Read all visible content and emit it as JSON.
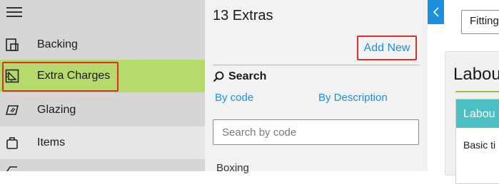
{
  "nav": {
    "menu_icon": "hamburger-icon",
    "items": [
      {
        "label": "Backing",
        "icon": "backing-icon"
      },
      {
        "label": "Extra Charges",
        "icon": "ruler-square-icon",
        "selected": true
      },
      {
        "label": "Glazing",
        "icon": "glazing-icon"
      },
      {
        "label": "Items",
        "icon": "items-icon"
      }
    ]
  },
  "list_panel": {
    "title": "13 Extras",
    "add_new_label": "Add New",
    "search_heading": "Search",
    "tabs": [
      "By code",
      "By Description"
    ],
    "search_placeholder": "Search by code",
    "first_item": "Boxing"
  },
  "detail_panel": {
    "fitting_select_value": "Fitting",
    "card_title": "Labou",
    "sub_card_header": "Labou",
    "sub_card_body": "Basic ti"
  },
  "colors": {
    "accent_blue": "#1e8fe0",
    "selected_green": "#b8d96b",
    "highlight_red": "#d9302c",
    "teal_header": "#4bbfc4"
  }
}
